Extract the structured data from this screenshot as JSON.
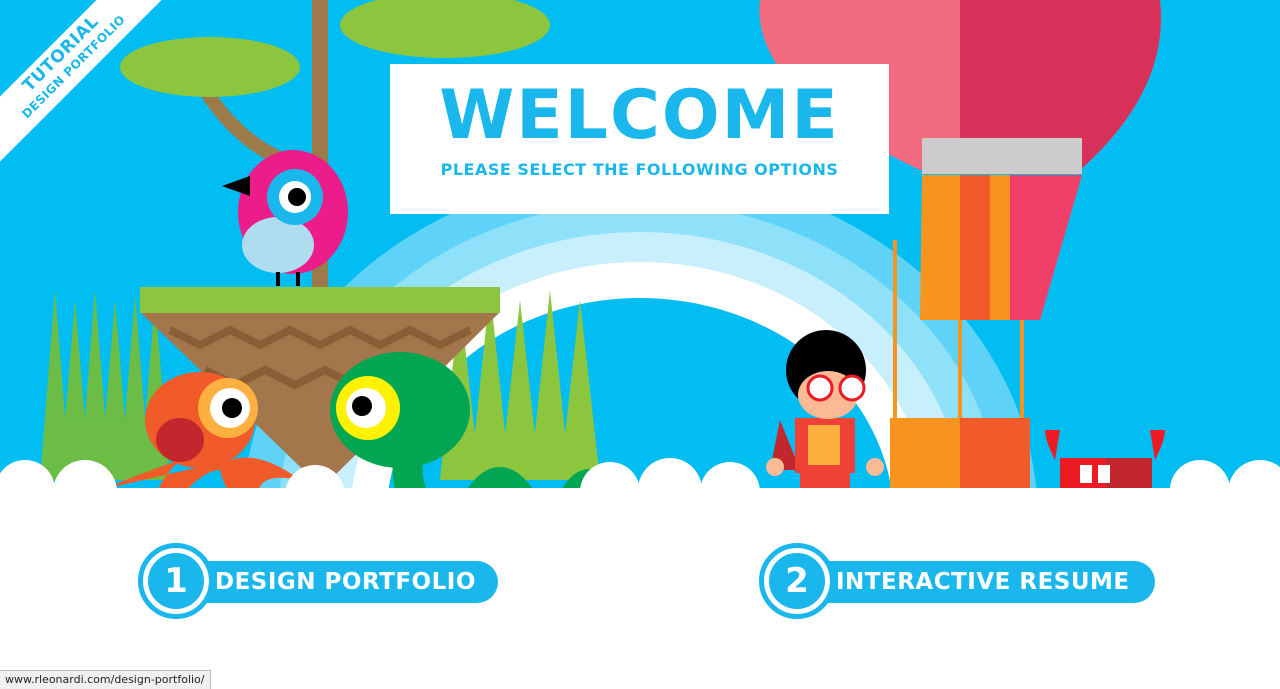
{
  "corner_ribbon": {
    "line1": "TUTORIAL",
    "line2": "DESIGN PORTFOLIO"
  },
  "banner": {
    "title": "WELCOME",
    "subtitle": "PLEASE SELECT THE FOLLOWING OPTIONS"
  },
  "options": [
    {
      "number": "1",
      "label": "DESIGN PORTFOLIO"
    },
    {
      "number": "2",
      "label": "INTERACTIVE RESUME"
    }
  ],
  "status_bar": {
    "url": "www.rleonardi.com/design-portfolio/"
  },
  "colors": {
    "sky": "#02bdf1",
    "accent": "#1ab7ec",
    "grass": "#8cc63f",
    "balloon_pink": "#f26b7e",
    "balloon_red": "#d9325a"
  },
  "icons": {
    "hero_character": "superhero-boy-icon",
    "crab": "red-crab-icon",
    "bird": "pink-bird-icon",
    "octopus": "orange-octopus-icon",
    "snake": "green-snake-icon",
    "balloon": "hot-air-balloon-icon"
  }
}
